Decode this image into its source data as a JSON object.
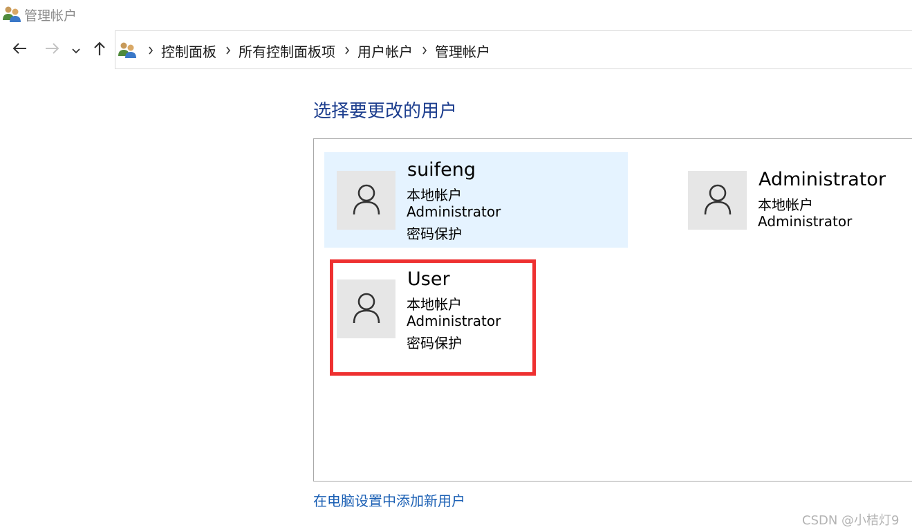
{
  "window": {
    "title": "管理帐户",
    "icon": "users-icon"
  },
  "navigation": {
    "back_icon": "arrow-left-icon",
    "forward_icon": "arrow-right-icon",
    "recent_icon": "chevron-down-icon",
    "up_icon": "arrow-up-icon"
  },
  "address_bar": {
    "icon": "users-icon",
    "breadcrumbs": [
      "控制面板",
      "所有控制面板项",
      "用户帐户",
      "管理帐户"
    ]
  },
  "main": {
    "heading": "选择要更改的用户",
    "users": [
      {
        "name": "suifeng",
        "lines": [
          "本地帐户",
          "Administrator",
          "密码保护"
        ],
        "selected": true
      },
      {
        "name": "Administrator",
        "lines": [
          "本地帐户",
          "Administrator"
        ],
        "selected": false
      },
      {
        "name": "User",
        "lines": [
          "本地帐户",
          "Administrator",
          "密码保护"
        ],
        "selected": false,
        "highlighted": true
      }
    ],
    "add_user_link": "在电脑设置中添加新用户"
  },
  "watermark": "CSDN @小桔灯9",
  "colors": {
    "heading": "#1e3f8f",
    "link": "#1a5fb4",
    "selection": "#e5f3ff",
    "highlight_border": "#ee3030",
    "avatar_bg": "#e6e6e6"
  }
}
